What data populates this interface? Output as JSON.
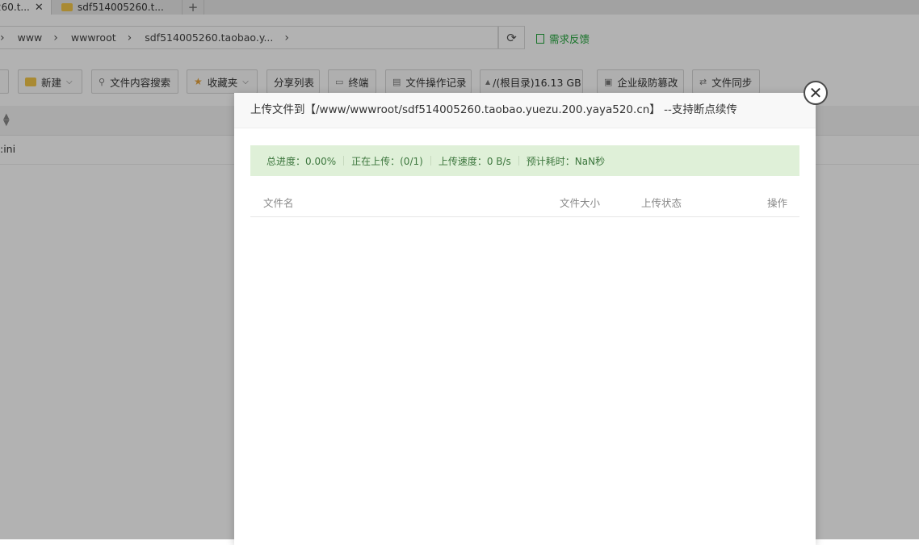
{
  "tabs": [
    {
      "label": "260.t...",
      "close": "✕"
    },
    {
      "label": "sdf514005260.t...",
      "close": ""
    }
  ],
  "new_tab": "+",
  "breadcrumb": {
    "items": [
      "www",
      "wwwroot",
      "sdf514005260.taobao.y..."
    ],
    "separator": "›"
  },
  "refresh_icon": "refresh-icon",
  "feedback_label": "需求反馈",
  "toolbar": {
    "new_label": "新建",
    "search_label": "文件内容搜索",
    "favorites_label": "收藏夹",
    "share_list_label": "分享列表",
    "terminal_label": "终端",
    "log_label": "文件操作记录",
    "disk_label": "/(根目录)16.13 GB",
    "tamper_label": "企业级防篡改",
    "sync_label": "文件同步"
  },
  "file_rows": [
    ":ini"
  ],
  "modal": {
    "title": "上传文件到【/www/wwwroot/sdf514005260.taobao.yuezu.200.yaya520.cn】 --支持断点续传",
    "close": "✕",
    "status": {
      "progress": "总进度：0.00%",
      "uploading": "正在上传：(0/1)",
      "speed": "上传速度：0 B/s",
      "eta": "预计耗时：NaN秒"
    },
    "columns": {
      "name": "文件名",
      "size": "文件大小",
      "state": "上传状态",
      "action": "操作"
    }
  },
  "colors": {
    "accent": "#20a53a",
    "status_bg": "#dff0d8",
    "status_text": "#3c763d",
    "folder": "#f3c64a"
  }
}
